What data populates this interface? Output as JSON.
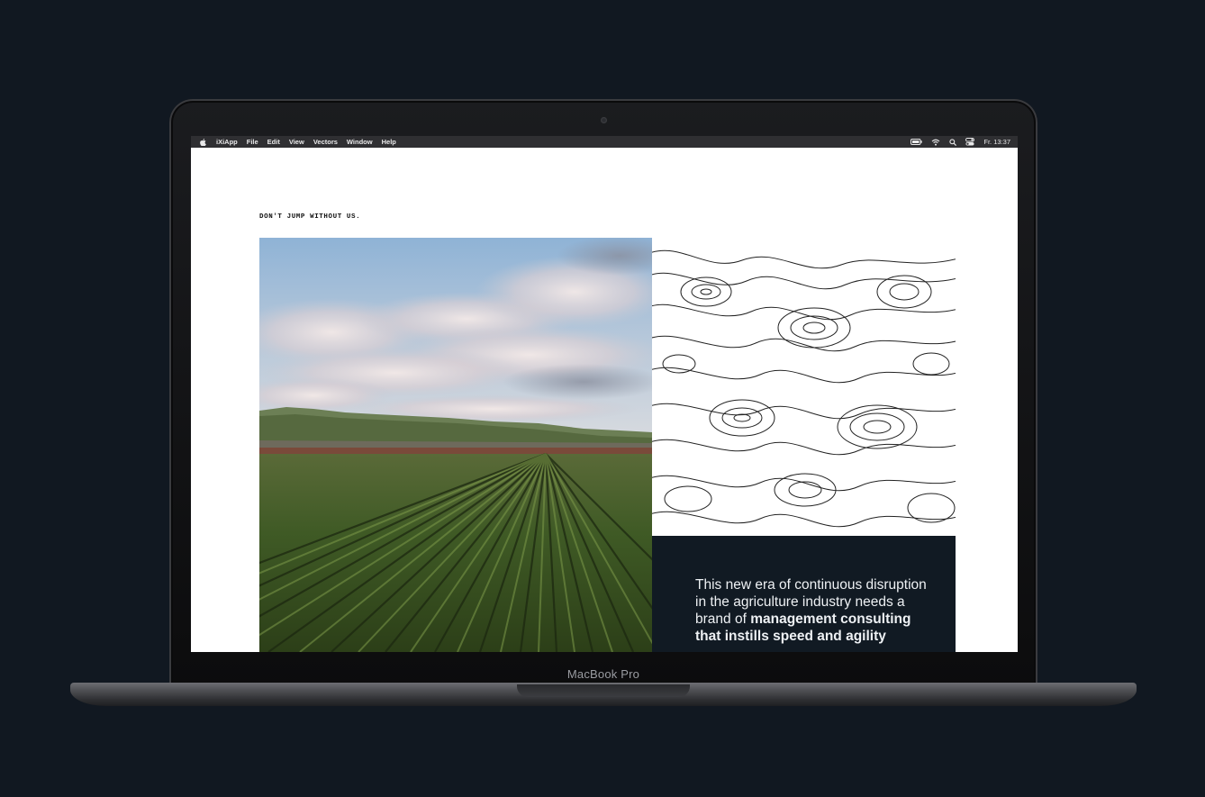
{
  "device": {
    "label": "MacBook Pro"
  },
  "menubar": {
    "app_name": "iXiApp",
    "items": [
      "File",
      "Edit",
      "View",
      "Vectors",
      "Window",
      "Help"
    ],
    "clock": "Fr. 13:37",
    "status_icons": [
      "battery-icon",
      "wifi-icon",
      "search-icon",
      "control-center-icon"
    ]
  },
  "page": {
    "tagline": "DON'T JUMP WITHOUT US.",
    "hero_image": "farm-field-photo",
    "pattern": "topographic-lines-pattern",
    "panel": {
      "text_regular": "This new era of continuous disruption in the agriculture industry needs a brand of",
      "text_bold": "management consulting that instills speed and agility"
    }
  },
  "colors": {
    "background": "#111821",
    "panel": "#111a23",
    "menubar": "#2f2f32"
  }
}
